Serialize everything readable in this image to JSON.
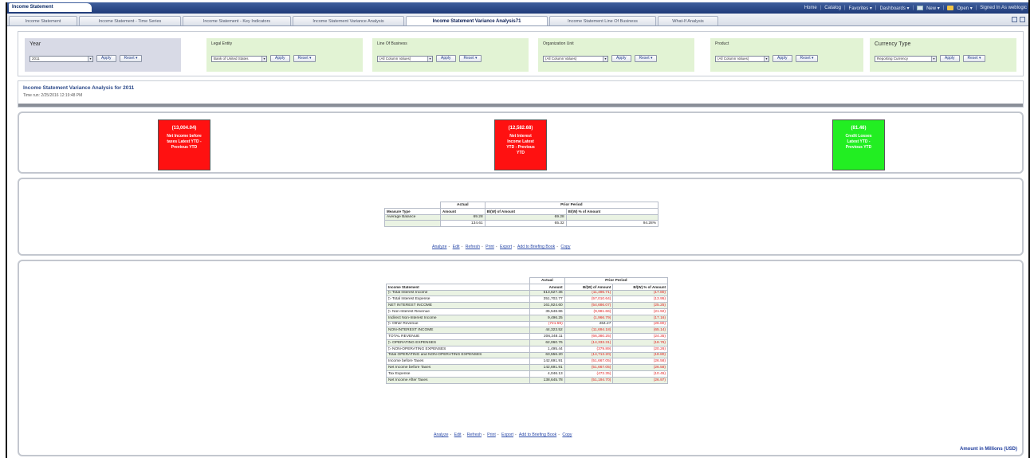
{
  "header": {
    "app_title": "Income Statement",
    "links": [
      "Home",
      "Catalog",
      "Favorites",
      "Dashboards",
      "New",
      "Open",
      "Signed In As  weblogic"
    ]
  },
  "tabs": [
    "Income Statement",
    "Income Statement - Time Series",
    "Income Statement - Key Indicators",
    "Income Statement Variance Analysis",
    "Income Statement Variance Analysis71",
    "Income Statement Line Of Business",
    "What-If Analysis"
  ],
  "prompts": {
    "year": {
      "label": "Year",
      "value": "2011"
    },
    "legal_entity": {
      "label": "Legal Entity",
      "value": "Bank of United States"
    },
    "lob": {
      "label": "Line Of Business",
      "value": "(All Column Values)"
    },
    "org_unit": {
      "label": "Organization Unit",
      "value": "(All Column Values)"
    },
    "product": {
      "label": "Product",
      "value": "(All Column Values)"
    },
    "currency": {
      "label": "Currency Type",
      "value": "Reporting Currency"
    },
    "apply": "Apply",
    "reset": "Reset"
  },
  "report": {
    "title": "Income Statement Variance Analysis for 2011",
    "time_run": "Time run: 2/25/2016 12:19:48 PM"
  },
  "kpis": [
    {
      "value": "(13,004.04)",
      "label": "Net Income before taxes Latest YTD - Previous YTD",
      "color": "#ff1111"
    },
    {
      "value": "(12,582.68)",
      "label": "Net Interest Income Latest YTD - Previous YTD",
      "color": "#ff1111"
    },
    {
      "value": "(81.46)",
      "label": "Credit Losses Latest YTD - Previous YTD",
      "color": "#22ee22"
    }
  ],
  "table1": {
    "group_actual": "Actual",
    "group_prior": "Prior Period",
    "col_amount": "Amount",
    "col_prior_amount": "B/(W) of Amount",
    "col_prior_pct": "B/(W) % of Amount",
    "row_head": "Measure Type",
    "rows": [
      {
        "label": "Average Balance",
        "amount": "69.28",
        "prior_amount": "69.28",
        "prior_pct": ""
      },
      {
        "label": "",
        "amount": "134.61",
        "prior_amount": "65.32",
        "prior_pct": "94.28%"
      }
    ]
  },
  "table2": {
    "group_actual": "Actual",
    "group_prior": "Prior Period",
    "row_head": "Income Statement",
    "col_amount": "Amount",
    "col_prior_amount": "B/(W) of Amount",
    "col_prior_pct": "B/(W) % of Amount",
    "rows": [
      {
        "label": "▷ Total Interest Income",
        "amount": "513,627.36",
        "b": "(11,496.71)",
        "p": "(17.80)"
      },
      {
        "label": "▷ Total Interest Expense",
        "amount": "351,702.77",
        "b": "(57,010.64)",
        "p": "(13.95)"
      },
      {
        "label": "NET INTEREST INCOME",
        "amount": "161,924.60",
        "b": "(54,686.07)",
        "p": "(25.25)"
      },
      {
        "label": "▷ Non-Interest Revenue",
        "amount": "35,548.86",
        "b": "(9,981.66)",
        "p": "(21.92)"
      },
      {
        "label": "Indirect Non-Interest Income",
        "amount": "9,496.25",
        "b": "(1,966.79)",
        "p": "(17.16)"
      },
      {
        "label": "▷ Other Revenue",
        "amount": "(721.59)",
        "b": "264.27",
        "p": "(26.80)"
      },
      {
        "label": "NON-INTEREST INCOME",
        "amount": "44,323.52",
        "b": "(11,694.18)",
        "p": "(65.14)"
      },
      {
        "label": "TOTAL REVENUE",
        "amount": "206,248.11",
        "b": "(66,380.25)",
        "p": "(24.35)"
      },
      {
        "label": "▷ OPERATING EXPENSES",
        "amount": "62,060.76",
        "b": "(14,333.31)",
        "p": "(18.76)"
      },
      {
        "label": "▷ NON-OPERATING EXPENSES",
        "amount": "1,495.44",
        "b": "(379.89)",
        "p": "(20.26)"
      },
      {
        "label": "Total OPERATING and NON-OPERATING EXPENSES",
        "amount": "63,556.20",
        "b": "(14,713.20)",
        "p": "(18.80)"
      },
      {
        "label": "Income before Taxes",
        "amount": "142,691.91",
        "b": "(51,667.05)",
        "p": "(26.58)"
      },
      {
        "label": "Net Income before Taxes",
        "amount": "142,691.91",
        "b": "(51,667.05)",
        "p": "(26.58)"
      },
      {
        "label": "Tax Expense",
        "amount": "4,046.13",
        "b": "(472.35)",
        "p": "(10.45)"
      },
      {
        "label": "Net Income After Taxes",
        "amount": "138,645.78",
        "b": "(51,194.70)",
        "p": "(26.97)"
      }
    ]
  },
  "actions": [
    "Analyze",
    "Edit",
    "Refresh",
    "Print",
    "Export",
    "Add to Briefing Book",
    "Copy"
  ],
  "units_label": "Amount in Millions (USD)"
}
